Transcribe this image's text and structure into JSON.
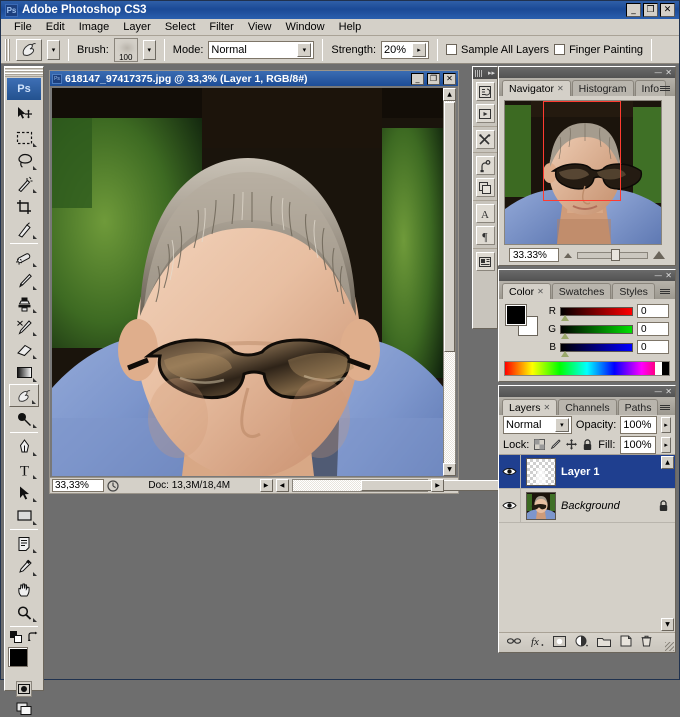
{
  "app": {
    "title": "Adobe Photoshop CS3",
    "logo_text": "Ps",
    "window_buttons": {
      "minimize": "_",
      "restore": "❐",
      "close": "✕"
    }
  },
  "menubar": {
    "items": [
      "File",
      "Edit",
      "Image",
      "Layer",
      "Select",
      "Filter",
      "View",
      "Window",
      "Help"
    ]
  },
  "options_bar": {
    "tool_icon": "smudge-tool",
    "brush_label": "Brush:",
    "brush_size": "100",
    "mode_label": "Mode:",
    "mode_value": "Normal",
    "strength_label": "Strength:",
    "strength_value": "20%",
    "sample_all_layers_label": "Sample All Layers",
    "sample_all_layers_checked": false,
    "finger_painting_label": "Finger Painting",
    "finger_painting_checked": false
  },
  "toolbox": {
    "logo": "Ps",
    "selected_tool": "smudge-tool",
    "groups": [
      [
        "move-tool",
        "marquee-tool",
        "lasso-tool",
        "magic-wand-tool",
        "crop-tool",
        "slice-tool"
      ],
      [
        "healing-brush-tool",
        "brush-tool",
        "clone-stamp-tool",
        "history-brush-tool",
        "eraser-tool",
        "gradient-tool",
        "smudge-tool",
        "dodge-tool"
      ],
      [
        "pen-tool",
        "type-tool",
        "path-selection-tool",
        "shape-tool"
      ],
      [
        "notes-tool",
        "eyedropper-tool",
        "hand-tool",
        "zoom-tool"
      ]
    ],
    "foreground_color": "#000000",
    "background_color": "#ffffff"
  },
  "document": {
    "title": "618147_97417375.jpg @ 33,3% (Layer 1, RGB/8#)",
    "zoom": "33,33%",
    "doc_info": "Doc: 13,3M/18,4M"
  },
  "icon_dock": {
    "items": [
      "history-icon",
      "actions-icon",
      "tool-presets-icon",
      "brushes-icon",
      "clone-source-icon",
      "character-icon",
      "paragraph-icon",
      "layer-comps-icon"
    ]
  },
  "navigator_panel": {
    "tabs": [
      {
        "label": "Navigator",
        "active": true,
        "closable": true
      },
      {
        "label": "Histogram",
        "active": false,
        "closable": false
      },
      {
        "label": "Info",
        "active": false,
        "closable": false
      }
    ],
    "zoom_value": "33.33%"
  },
  "color_panel": {
    "tabs": [
      {
        "label": "Color",
        "active": true,
        "closable": true
      },
      {
        "label": "Swatches",
        "active": false,
        "closable": false
      },
      {
        "label": "Styles",
        "active": false,
        "closable": false
      }
    ],
    "channels": [
      {
        "name": "R",
        "value": "0"
      },
      {
        "name": "G",
        "value": "0"
      },
      {
        "name": "B",
        "value": "0"
      }
    ],
    "foreground": "#000000",
    "background": "#ffffff"
  },
  "layers_panel": {
    "tabs": [
      {
        "label": "Layers",
        "active": true,
        "closable": true
      },
      {
        "label": "Channels",
        "active": false,
        "closable": false
      },
      {
        "label": "Paths",
        "active": false,
        "closable": false
      }
    ],
    "blend_mode": "Normal",
    "opacity_label": "Opacity:",
    "opacity_value": "100%",
    "lock_label": "Lock:",
    "lock_icons": [
      "lock-transparent-icon",
      "lock-pixels-icon",
      "lock-position-icon",
      "lock-all-icon"
    ],
    "fill_label": "Fill:",
    "fill_value": "100%",
    "layers": [
      {
        "name": "Layer 1",
        "selected": true,
        "visible": true,
        "locked": false,
        "thumb": "transparent"
      },
      {
        "name": "Background",
        "selected": false,
        "visible": true,
        "locked": true,
        "thumb": "photo"
      }
    ],
    "footer_icons": [
      "link-layers-icon",
      "layer-style-icon",
      "layer-mask-icon",
      "adjustment-layer-icon",
      "new-group-icon",
      "new-layer-icon",
      "delete-layer-icon"
    ]
  }
}
